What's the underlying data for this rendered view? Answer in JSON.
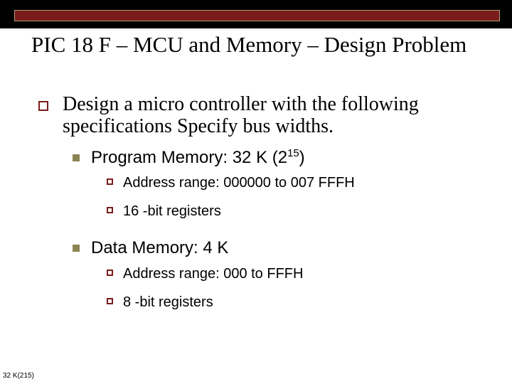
{
  "title": "PIC 18 F – MCU and Memory – Design Problem",
  "body": {
    "intro": "Design a micro controller with the following specifications Specify bus widths.",
    "items": [
      {
        "label_prefix": "Program Memory: 32 K (2",
        "label_exp": "15",
        "label_suffix": ")",
        "sub": [
          "Address range: 000000 to 007 FFFH",
          "16 -bit registers"
        ]
      },
      {
        "label_prefix": "Data Memory: 4 K",
        "label_exp": "",
        "label_suffix": "",
        "sub": [
          "Address range: 000 to FFFH",
          "8 -bit registers"
        ]
      }
    ]
  },
  "footnote": "32 K(215)"
}
